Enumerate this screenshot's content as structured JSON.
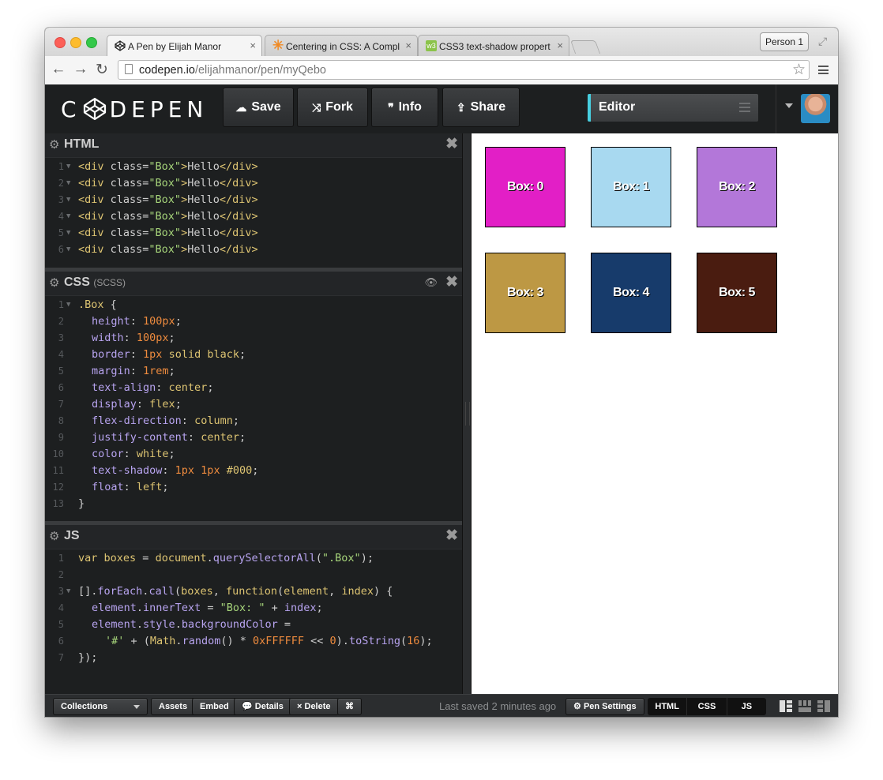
{
  "browser": {
    "tabs": [
      {
        "title": "A Pen by Elijah Manor",
        "favicon": "codepen-icon"
      },
      {
        "title": "Centering in CSS: A Compl",
        "favicon": "asterisk-icon"
      },
      {
        "title": "CSS3 text-shadow propert",
        "favicon": "w3-icon"
      }
    ],
    "close_glyph": "×",
    "person_label": "Person 1",
    "url_domain": "codepen.io",
    "url_path": "/elijahmanor/pen/myQebo"
  },
  "header": {
    "logo_text_1": "C",
    "logo_text_2": "DEPEN",
    "buttons": {
      "save": "Save",
      "fork": "Fork",
      "info": "Info",
      "share": "Share"
    },
    "editor_label": "Editor"
  },
  "html_pane": {
    "title": "HTML",
    "line_numbers": [
      "1",
      "2",
      "3",
      "4",
      "5",
      "6"
    ],
    "line_text": {
      "open": "<div",
      "attr": " class=",
      "value": "\"Box\"",
      "close": ">",
      "content": "Hello",
      "end": "</div>"
    }
  },
  "css_pane": {
    "title": "CSS",
    "subtitle": "(SCSS)",
    "line_numbers": [
      "1",
      "2",
      "3",
      "4",
      "5",
      "6",
      "7",
      "8",
      "9",
      "10",
      "11",
      "12",
      "13"
    ],
    "selector": ".Box",
    "open_brace": " {",
    "close_brace": "}",
    "declarations": [
      {
        "prop": "height",
        "value": "100px",
        "kind": "num"
      },
      {
        "prop": "width",
        "value": "100px",
        "kind": "num"
      },
      {
        "prop": "border",
        "value_num": "1px",
        "value_rest": " solid black",
        "kind": "mixed"
      },
      {
        "prop": "margin",
        "value": "1rem",
        "kind": "num"
      },
      {
        "prop": "text-align",
        "value": "center",
        "kind": "val"
      },
      {
        "prop": "display",
        "value": "flex",
        "kind": "val"
      },
      {
        "prop": "flex-direction",
        "value": "column",
        "kind": "val"
      },
      {
        "prop": "justify-content",
        "value": "center",
        "kind": "val"
      },
      {
        "prop": "color",
        "value": "white",
        "kind": "val"
      },
      {
        "prop": "text-shadow",
        "value_num": "1px 1px",
        "value_rest": " #000",
        "kind": "mixed"
      },
      {
        "prop": "float",
        "value": "left",
        "kind": "val"
      }
    ]
  },
  "js_pane": {
    "title": "JS",
    "line_numbers": [
      "1",
      "2",
      "3",
      "4",
      "5",
      "6",
      "7"
    ],
    "l1": {
      "kw": "var",
      "name": " boxes",
      "eq": " = ",
      "obj": "document",
      "dot": ".",
      "fn": "querySelectorAll",
      "open": "(",
      "str": "\".Box\"",
      "end": ");"
    },
    "l3": {
      "pre": "[].",
      "fn1": "forEach",
      "dot": ".",
      "fn2": "call",
      "open": "(",
      "a1": "boxes",
      "comma": ", ",
      "kw": "function",
      "p": "(",
      "a2": "element",
      "c2": ", ",
      "a3": "index",
      "end": ") {"
    },
    "l4": {
      "obj": "element",
      "dot": ".",
      "prop": "innerText",
      "eq": " = ",
      "str": "\"Box: \"",
      "plus": " + ",
      "var": "index",
      "end": ";"
    },
    "l5": {
      "obj": "element",
      "dot1": ".",
      "p1": "style",
      "dot2": ".",
      "p2": "backgroundColor",
      "eq": " ="
    },
    "l6": {
      "str": "'#'",
      "plus": " + (",
      "obj": "Math",
      "dot": ".",
      "fn": "random",
      "call": "() * ",
      "hex": "0xFFFFFF",
      "shift": " << ",
      "zero": "0",
      "close": ").",
      "fn2": "toString",
      "open": "(",
      "sixteen": "16",
      "end": ");"
    },
    "l7": "});"
  },
  "preview": {
    "boxes": [
      {
        "label": "Box: 0",
        "color": "#e21fc6"
      },
      {
        "label": "Box: 1",
        "color": "#a8d9f0"
      },
      {
        "label": "Box: 2",
        "color": "#b377d9"
      },
      {
        "label": "Box: 3",
        "color": "#bd9844"
      },
      {
        "label": "Box: 4",
        "color": "#173b6b"
      },
      {
        "label": "Box: 5",
        "color": "#4a1c10"
      }
    ]
  },
  "footer": {
    "collections": "Collections",
    "assets": "Assets",
    "embed": "Embed",
    "details": "Details",
    "delete": "Delete",
    "cmd": "⌘",
    "saved_text": "Last saved 2 minutes ago",
    "pen_settings": "Pen Settings",
    "view_tabs": [
      "HTML",
      "CSS",
      "JS"
    ]
  },
  "colors": {
    "accent": "#47cfe0",
    "editor_bg": "#1d1f20"
  }
}
